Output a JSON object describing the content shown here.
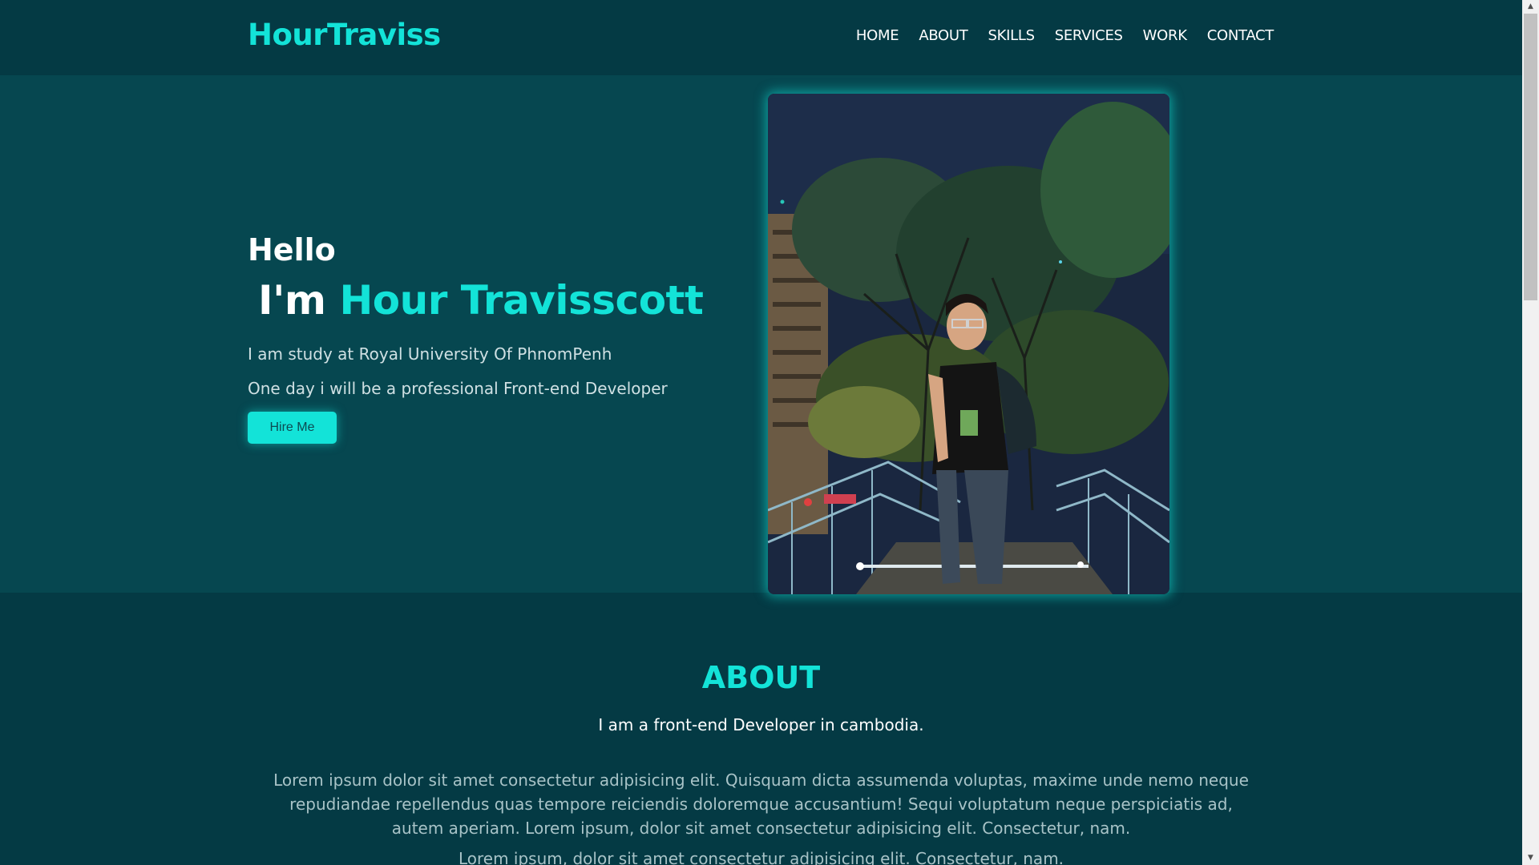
{
  "header": {
    "logo": "HourTraviss",
    "nav": [
      "HOME",
      "ABOUT",
      "SKILLS",
      "SERVICES",
      "WORK",
      "CONTACT"
    ]
  },
  "hero": {
    "greeting": "Hello",
    "intro_prefix": "I'm",
    "name": "Hour Travisscott",
    "line1": "I am study at Royal University Of PhnomPenh",
    "line2": "One day i will be a professional Front-end Developer",
    "button": "Hire Me"
  },
  "about": {
    "title": "ABOUT",
    "subtitle": "I am a front-end Developer in cambodia.",
    "paragraph": "Lorem ipsum dolor sit amet consectetur adipisicing elit. Quisquam dicta assumenda voluptas, maxime unde nemo neque repudiandae repellendus quas tempore reiciendis doloremque accusantium! Sequi voluptatum neque perspiciatis ad, autem aperiam. Lorem ipsum, dolor sit amet consectetur adipisicing elit. Consectetur, nam.",
    "paragraph2": "Lorem ipsum, dolor sit amet consectetur adipisicing elit. Consectetur, nam."
  },
  "colors": {
    "accent": "#13e3d8",
    "background": "#043a44",
    "hero_background": "#064750"
  },
  "icons": {
    "scroll_up": "triangle-up-icon",
    "scroll_down": "triangle-down-icon"
  }
}
